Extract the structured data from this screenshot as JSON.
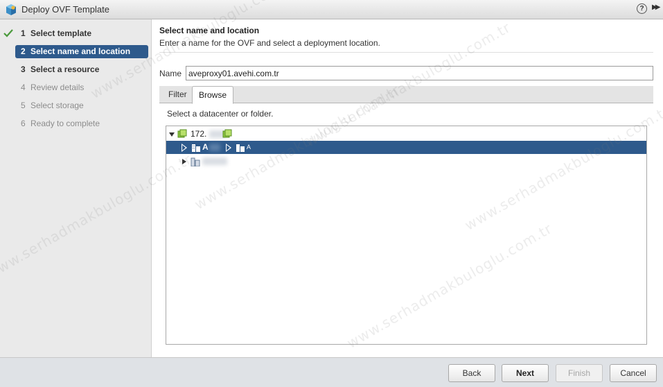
{
  "window": {
    "title": "Deploy OVF Template"
  },
  "steps": [
    {
      "num": "1",
      "label": "Select template",
      "state": "done"
    },
    {
      "num": "2",
      "label": "Select name and location",
      "state": "active"
    },
    {
      "num": "3",
      "label": "Select a resource",
      "state": "current"
    },
    {
      "num": "4",
      "label": "Review details",
      "state": "pending"
    },
    {
      "num": "5",
      "label": "Select storage",
      "state": "pending"
    },
    {
      "num": "6",
      "label": "Ready to complete",
      "state": "pending"
    }
  ],
  "main": {
    "title": "Select name and location",
    "subtitle": "Enter a name for the OVF and select a deployment location.",
    "name_label": "Name",
    "name_value": "aveproxy01.avehi.com.tr",
    "tabs": [
      "Filter",
      "Browse"
    ],
    "hint": "Select a datacenter or folder.",
    "tree": {
      "root_label": "172.",
      "selected_label_a": "A",
      "selected_label_b": "A"
    }
  },
  "buttons": {
    "back": "Back",
    "next": "Next",
    "finish": "Finish",
    "cancel": "Cancel"
  },
  "icons": {
    "app": "ovf-package-icon",
    "help": "help-icon",
    "expand": "expand-panel-icon",
    "check": "check-icon",
    "vcenter": "vcenter-icon",
    "datacenter": "datacenter-icon"
  },
  "watermark": "www.serhadmakbuloglu.com.tr",
  "colors": {
    "accent": "#2e5a8c",
    "check": "#4a9a3c"
  }
}
